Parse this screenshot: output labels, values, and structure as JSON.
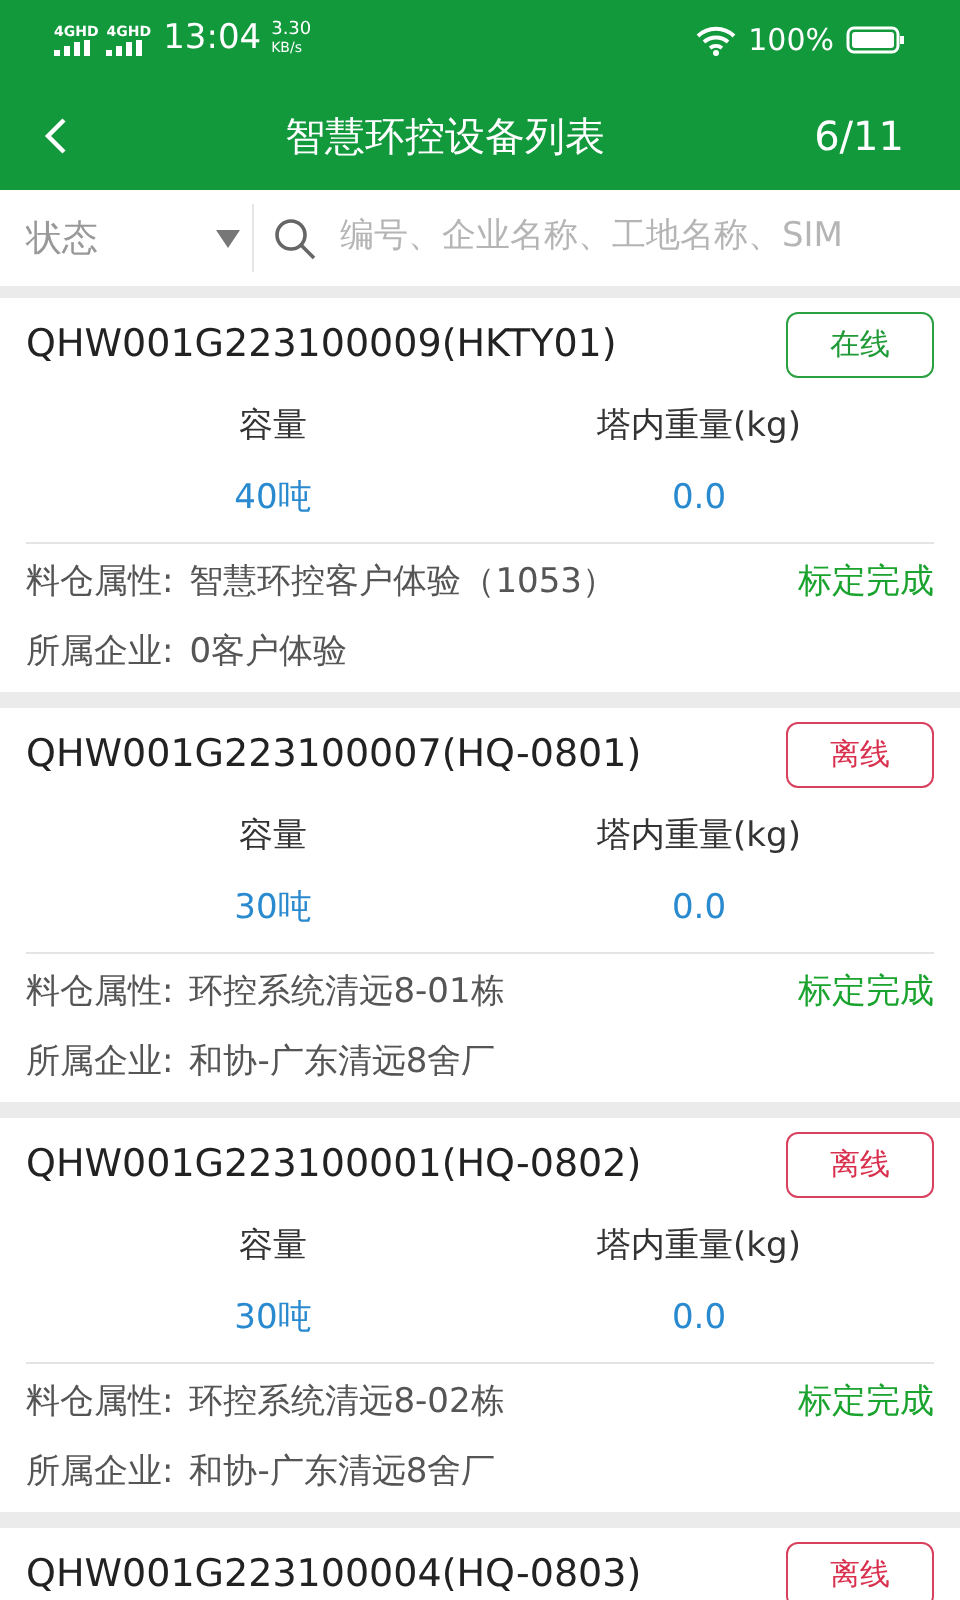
{
  "status_bar": {
    "network_1": "4GHD",
    "network_2": "4GHD",
    "time": "13:04",
    "speed_value": "3.30",
    "speed_unit": "KB/s",
    "battery": "100%"
  },
  "header": {
    "title": "智慧环控设备列表",
    "page": "6/11"
  },
  "filter": {
    "status_label": "状态",
    "search": {
      "placeholder": "编号、企业名称、工地名称、SIM"
    }
  },
  "devices": [
    {
      "title": "QHW001G223100009(HKTY01)",
      "status": "在线",
      "online": true,
      "capacity_label": "容量",
      "capacity": "40吨",
      "weight_label": "塔内重量(kg)",
      "weight": "0.0",
      "bin_label": "料仓属性:",
      "bin": "智慧环控客户体验（1053）",
      "calibration": "标定完成",
      "company_label": "所属企业:",
      "company": "0客户体验"
    },
    {
      "title": "QHW001G223100007(HQ-0801)",
      "status": "离线",
      "online": false,
      "capacity_label": "容量",
      "capacity": "30吨",
      "weight_label": "塔内重量(kg)",
      "weight": "0.0",
      "bin_label": "料仓属性:",
      "bin": "环控系统清远8-01栋",
      "calibration": "标定完成",
      "company_label": "所属企业:",
      "company": "和协-广东清远8舍厂"
    },
    {
      "title": "QHW001G223100001(HQ-0802)",
      "status": "离线",
      "online": false,
      "capacity_label": "容量",
      "capacity": "30吨",
      "weight_label": "塔内重量(kg)",
      "weight": "0.0",
      "bin_label": "料仓属性:",
      "bin": "环控系统清远8-02栋",
      "calibration": "标定完成",
      "company_label": "所属企业:",
      "company": "和协-广东清远8舍厂"
    },
    {
      "title": "QHW001G223100004(HQ-0803)",
      "status": "离线",
      "online": false
    }
  ]
}
